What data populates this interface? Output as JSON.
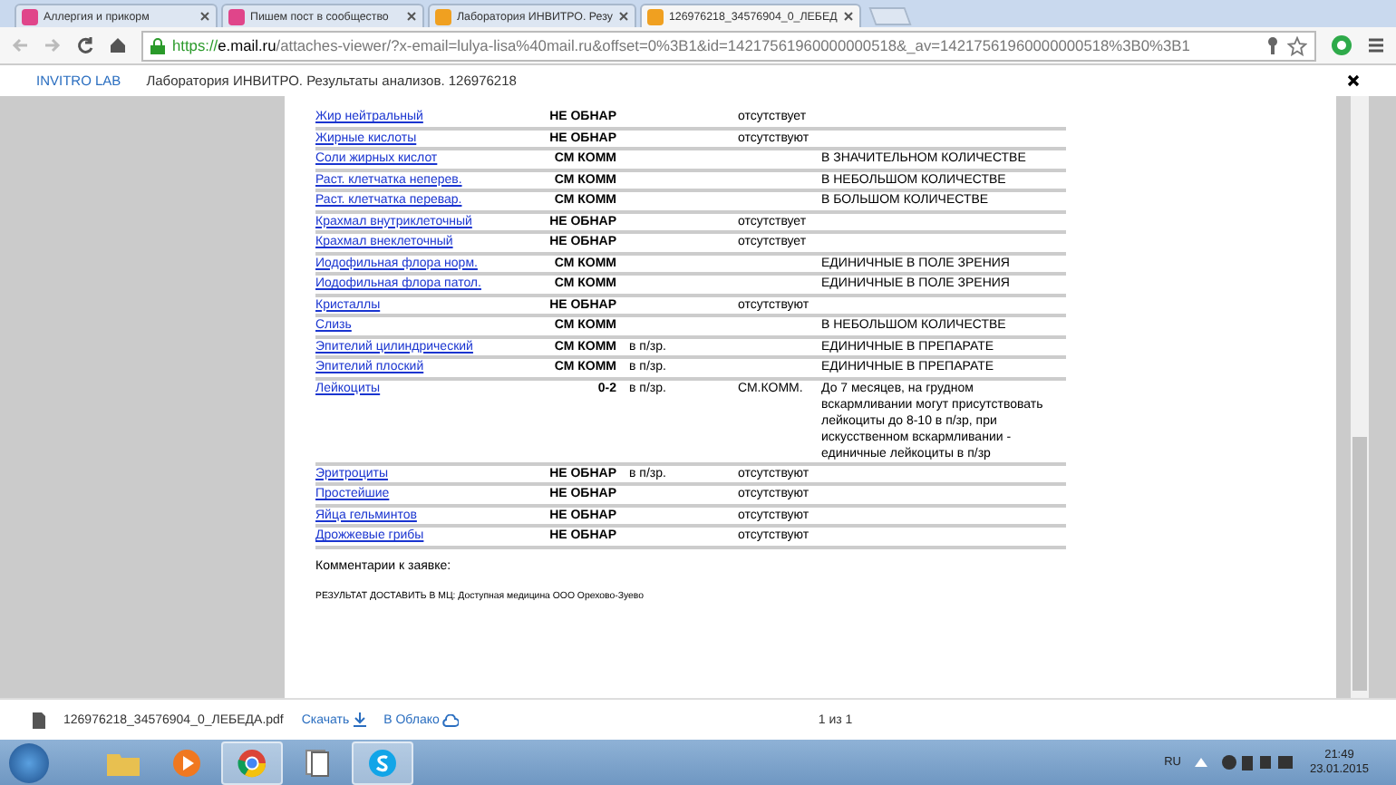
{
  "browser": {
    "tabs": [
      {
        "title": "Аллергия и прикорм",
        "selected": false
      },
      {
        "title": "Пишем пост в сообщество",
        "selected": false
      },
      {
        "title": "Лаборатория ИНВИТРО. Резу",
        "selected": false
      },
      {
        "title": "126976218_34576904_0_ЛЕБЕД",
        "selected": true
      }
    ],
    "url_scheme": "https://",
    "url_host": "e.mail.ru",
    "url_path": "/attaches-viewer/?x-email=lulya-lisa%40mail.ru&offset=0%3B1&id=14217561960000000518&_av=14217561960000000518%3B0%3B1"
  },
  "header": {
    "sender": "INVITRO LAB",
    "subject": "Лаборатория ИНВИТРО. Результаты анализов. 126976218"
  },
  "results": [
    {
      "name": "Жир нейтральный",
      "result": "НЕ ОБНАР",
      "norm": "отсутствует"
    },
    {
      "name": "Жирные кислоты",
      "result": "НЕ ОБНАР",
      "norm": "отсутствуют"
    },
    {
      "name": "Соли жирных кислот",
      "result": "СМ КОММ",
      "comment": "В ЗНАЧИТЕЛЬНОМ КОЛИЧЕСТВЕ"
    },
    {
      "name": "Раст. клетчатка неперев.",
      "result": "СМ КОММ",
      "comment": "В НЕБОЛЬШОМ КОЛИЧЕСТВЕ"
    },
    {
      "name": "Раст. клетчатка перевар.",
      "result": "СМ КОММ",
      "comment": "В БОЛЬШОМ КОЛИЧЕСТВЕ"
    },
    {
      "name": "Крахмал внутриклеточный",
      "result": "НЕ ОБНАР",
      "norm": "отсутствует"
    },
    {
      "name": "Крахмал внеклеточный",
      "result": "НЕ ОБНАР",
      "norm": "отсутствует"
    },
    {
      "name": "Иодофильная флора норм.",
      "result": "СМ КОММ",
      "comment": "ЕДИНИЧНЫЕ В ПОЛЕ ЗРЕНИЯ"
    },
    {
      "name": "Иодофильная флора патол.",
      "result": "СМ КОММ",
      "comment": "ЕДИНИЧНЫЕ В ПОЛЕ ЗРЕНИЯ"
    },
    {
      "name": "Кристаллы",
      "result": "НЕ ОБНАР",
      "norm": "отсутствуют"
    },
    {
      "name": "Слизь",
      "result": "СМ КОММ",
      "comment": "В НЕБОЛЬШОМ КОЛИЧЕСТВЕ"
    },
    {
      "name": "Эпителий цилиндрический",
      "result": "СМ КОММ",
      "unit": "в п/зр.",
      "comment": "ЕДИНИЧНЫЕ В ПРЕПАРАТЕ"
    },
    {
      "name": "Эпителий плоский",
      "result": "СМ КОММ",
      "unit": "в п/зр.",
      "comment": "ЕДИНИЧНЫЕ В ПРЕПАРАТЕ"
    },
    {
      "name": "Лейкоциты",
      "result": "0-2",
      "unit": "в п/зр.",
      "norm": "СМ.КОММ.",
      "comment": "До 7 месяцев, на грудном вскармливании могут присутствовать лейкоциты до 8-10 в п/зр, при искусственном вскармливании - единичные лейкоциты в п/зр"
    },
    {
      "name": "Эритроциты",
      "result": "НЕ ОБНАР",
      "unit": "в п/зр.",
      "norm": "отсутствуют"
    },
    {
      "name": "Простейшие",
      "result": "НЕ ОБНАР",
      "norm": "отсутствуют"
    },
    {
      "name": "Яйца гельминтов",
      "result": "НЕ ОБНАР",
      "norm": "отсутствуют"
    },
    {
      "name": "Дрожжевые грибы",
      "result": "НЕ ОБНАР",
      "norm": "отсутствуют"
    }
  ],
  "comments_label": "Комментарии к заявке:",
  "delivery_note": "РЕЗУЛЬТАТ ДОСТАВИТЬ В МЦ: Доступная медицина ООО Орехово-Зуево",
  "footer": {
    "file_name": "126976218_34576904_0_ЛЕБЕДА.pdf",
    "download": "Скачать",
    "cloud": "В Облако",
    "pages": "1 из 1"
  },
  "taskbar": {
    "language": "RU",
    "time": "21:49",
    "date": "23.01.2015"
  }
}
